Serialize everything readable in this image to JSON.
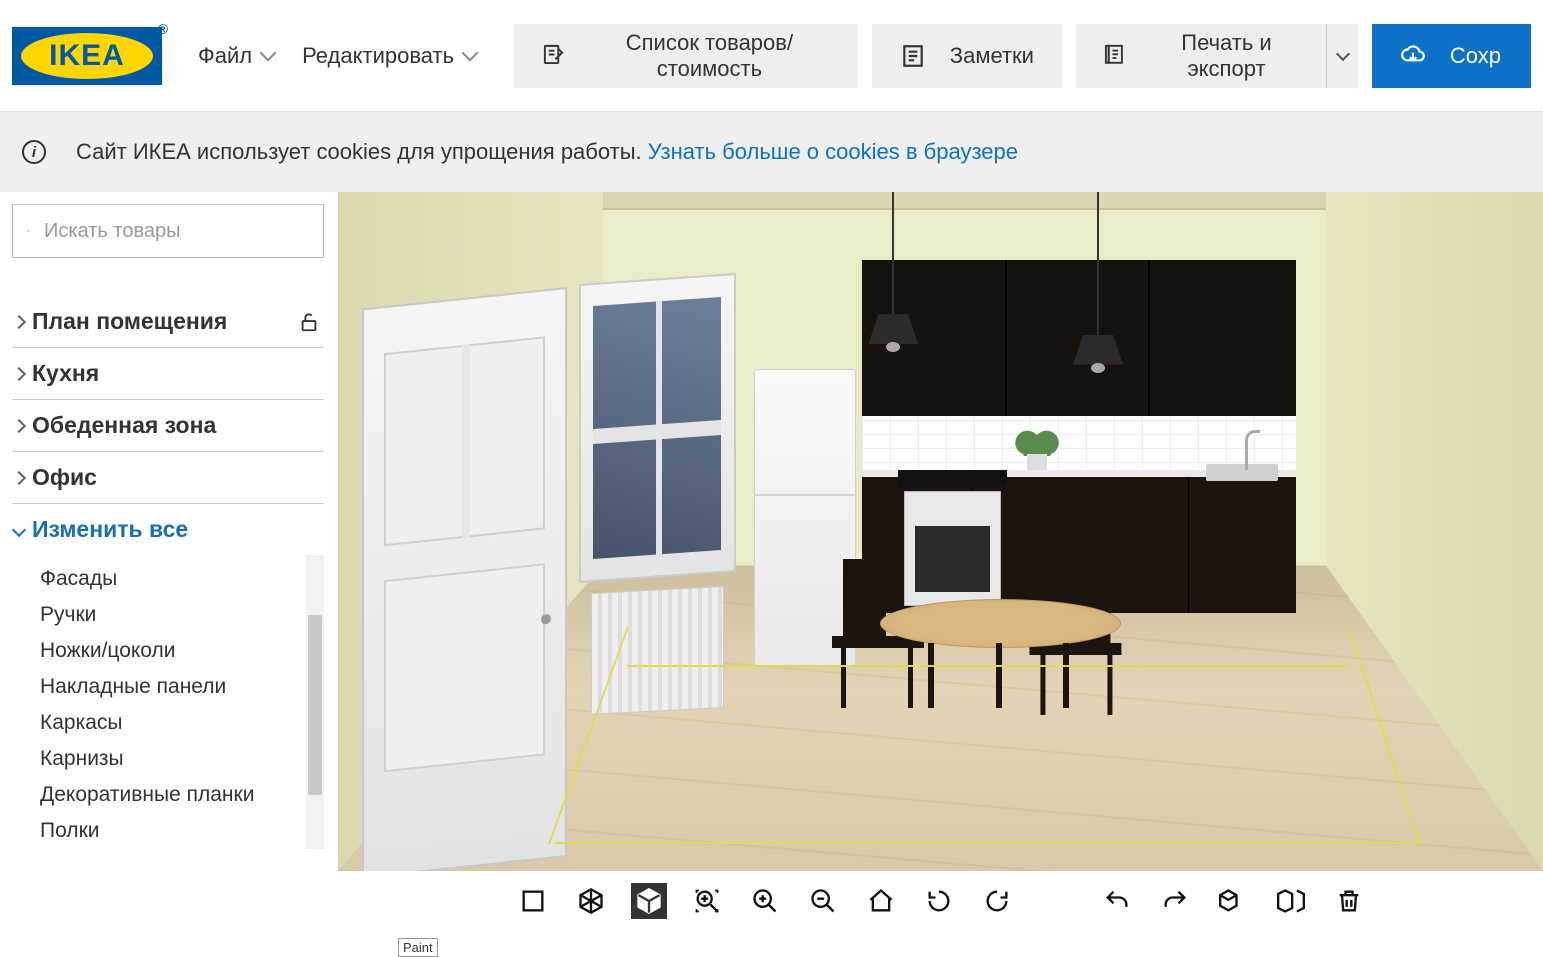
{
  "logo": {
    "text": "IKEA",
    "registered": "®"
  },
  "menubar": {
    "file": "Файл",
    "edit": "Редактировать"
  },
  "top_buttons": {
    "product_list": "Список товаров/стоимость",
    "notes": "Заметки",
    "print_export": "Печать и экспорт",
    "save": "Сохр"
  },
  "cookie_banner": {
    "text": "Сайт ИКЕА использует cookies для упрощения работы. ",
    "link": "Узнать больше о cookies в браузере"
  },
  "search": {
    "placeholder": "Искать товары"
  },
  "accordion": {
    "room_plan": "План помещения",
    "kitchen": "Кухня",
    "dining": "Обеденная зона",
    "office": "Офис",
    "change_all": "Изменить все",
    "sub": {
      "fronts": "Фасады",
      "handles": "Ручки",
      "legs": "Ножки/цоколи",
      "cover_panels": "Накладные панели",
      "frames": "Каркасы",
      "cornices": "Карнизы",
      "deco_strips": "Декоративные планки",
      "shelves": "Полки"
    }
  },
  "paint_label": "Paint"
}
